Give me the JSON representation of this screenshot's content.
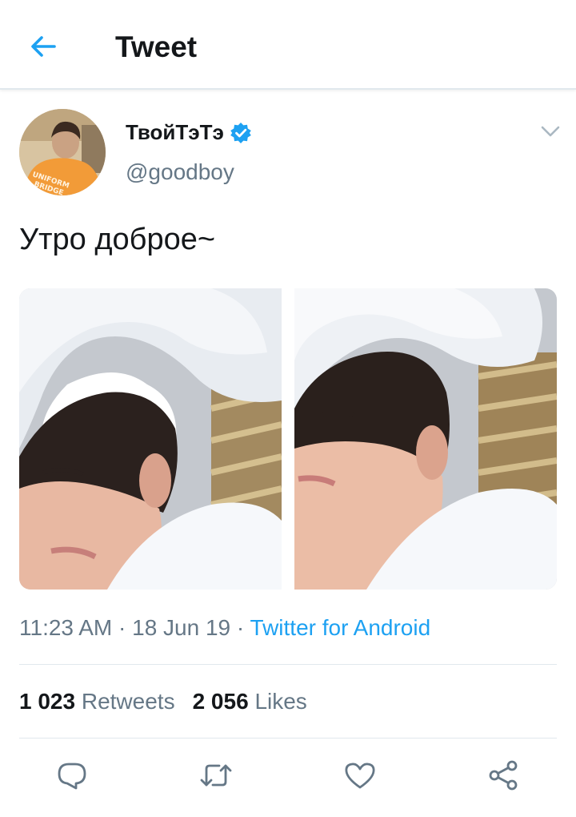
{
  "header": {
    "title": "Tweet"
  },
  "tweet": {
    "author": {
      "display_name": "ТвойТэТэ",
      "handle": "@goodboy",
      "verified": true
    },
    "text": "Утро доброе~",
    "time": "11:23 AM",
    "separator": " · ",
    "date": "18 Jun 19",
    "source": "Twitter for Android",
    "retweets": {
      "count": "1 023",
      "label": "Retweets"
    },
    "likes": {
      "count": "2 056",
      "label": "Likes"
    }
  },
  "avatar_shirt_text": {
    "line1": "UNIFORM",
    "line2": "BRIDGE"
  },
  "colors": {
    "accent": "#1da1f2",
    "secondary_text": "#657786",
    "primary_text": "#14171a",
    "divider": "#e1e8ed"
  },
  "icons": {
    "back": "arrow-left-icon",
    "verified": "verified-badge-icon",
    "menu": "chevron-down-icon",
    "reply": "reply-icon",
    "retweet": "retweet-icon",
    "like": "heart-icon",
    "share": "share-icon"
  }
}
